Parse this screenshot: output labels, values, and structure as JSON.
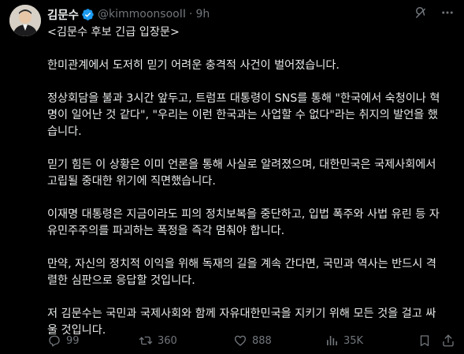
{
  "post": {
    "author_name": "김문수",
    "handle": "@kimmoonsooII",
    "separator": "·",
    "time": "9h",
    "lines": [
      "<김문수 후보 긴급 입장문>",
      "",
      "한미관계에서 도저히 믿기 어려운 충격적 사건이 벌어졌습니다.",
      "",
      "정상회담을 불과 3시간 앞두고, 트럼프 대통령이 SNS를 통해 \"한국에서 숙청이나 혁",
      "명이 일어난 것 같다\", \"우리는 이런 한국과는 사업할 수 없다\"라는 취지의 발언을 했",
      "습니다.",
      "",
      "믿기 힘든 이 상황은 이미 언론을 통해 사실로 알려졌으며, 대한민국은 국제사회에서",
      "고립될 중대한 위기에 직면했습니다.",
      "",
      "이재명 대통령은 지금이라도 피의 정치보복을 중단하고, 입법 폭주와 사법 유린 등 자",
      "유민주주의를 파괴하는 폭정을 즉각 멈춰야 합니다.",
      "",
      "만약, 자신의 정치적 이익을 위해 독재의 길을 계속 간다면, 국민과 역사는 반드시 격",
      "렬한 심판으로 응답할 것입니다.",
      "",
      "저 김문수는 국민과 국제사회와 함께 자유대한민국을 지키기 위해 모든 것을 걸고 싸",
      "울 것입니다."
    ]
  },
  "actions": {
    "replies": "99",
    "reposts": "360",
    "likes": "888",
    "views": "35K"
  },
  "icons": {
    "verified": "verified-badge-icon",
    "grok": "grok-icon",
    "more": "more-icon",
    "reply": "reply-icon",
    "repost": "repost-icon",
    "like": "heart-icon",
    "views": "views-icon",
    "bookmark": "bookmark-icon",
    "share": "share-icon"
  },
  "colors": {
    "background": "#000000",
    "text": "#e7e9ea",
    "secondary": "#71767b",
    "verified": "#1d9bf0"
  }
}
